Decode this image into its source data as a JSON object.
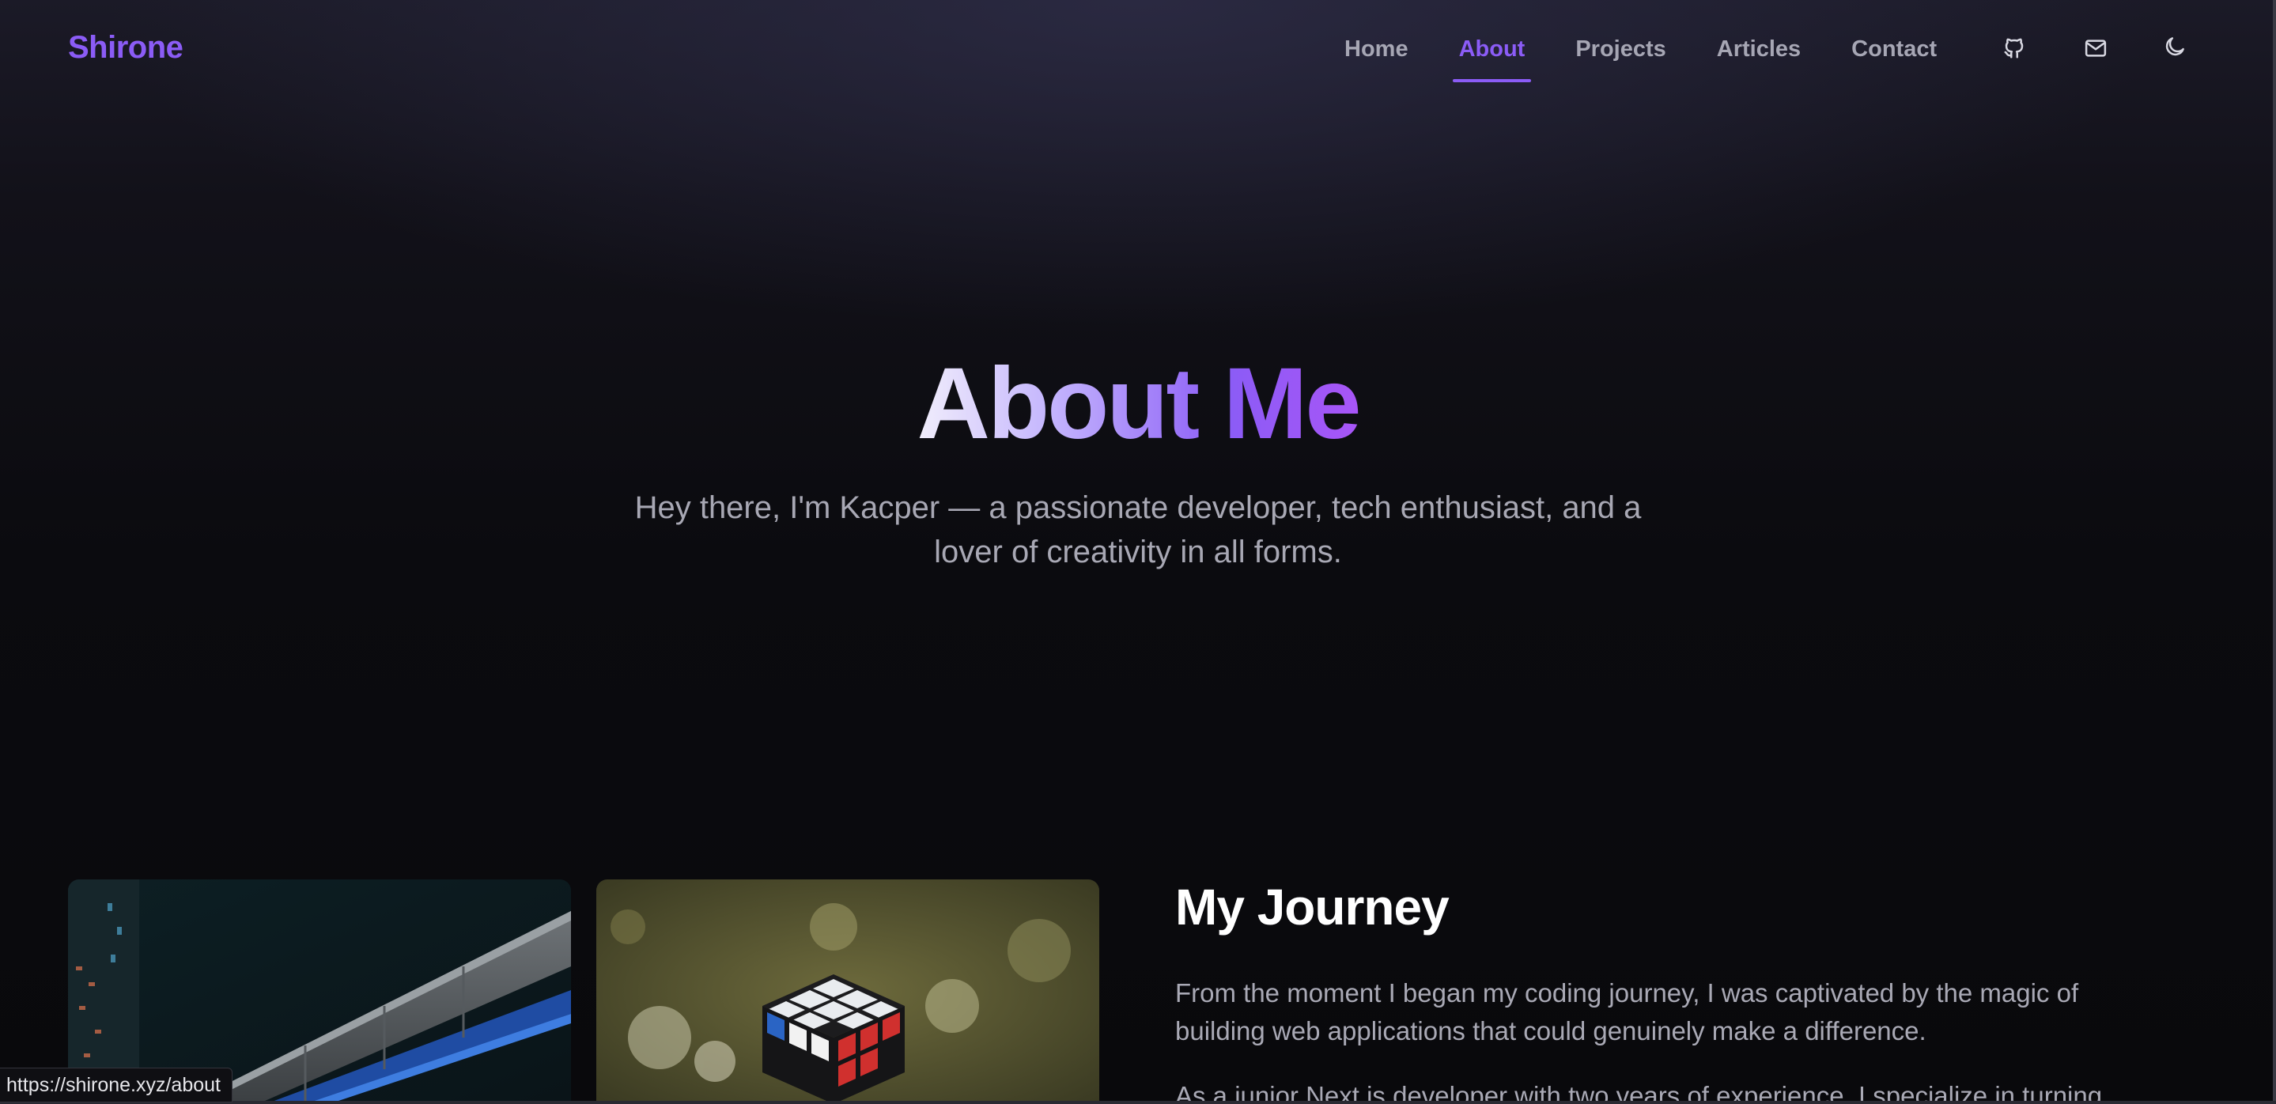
{
  "header": {
    "logo": "Shirone",
    "nav": [
      {
        "label": "Home",
        "active": false
      },
      {
        "label": "About",
        "active": true
      },
      {
        "label": "Projects",
        "active": false
      },
      {
        "label": "Articles",
        "active": false
      },
      {
        "label": "Contact",
        "active": false
      }
    ],
    "icons": [
      "github-icon",
      "mail-icon",
      "moon-icon"
    ]
  },
  "hero": {
    "title": "About Me",
    "subtitle": "Hey there, I'm Kacper — a passionate developer, tech enthusiast, and a lover of creativity in all forms."
  },
  "journey": {
    "title": "My Journey",
    "paragraphs": [
      "From the moment I began my coding journey, I was captivated by the magic of building web applications that could genuinely make a difference.",
      "As a junior Next.js developer with two years of experience, I specialize in turning"
    ]
  },
  "status_bar": {
    "url": "https://shirone.xyz/about"
  },
  "colors": {
    "accent": "#8b5cf6",
    "background": "#0a0a0d",
    "muted_text": "#a8a8b4"
  }
}
